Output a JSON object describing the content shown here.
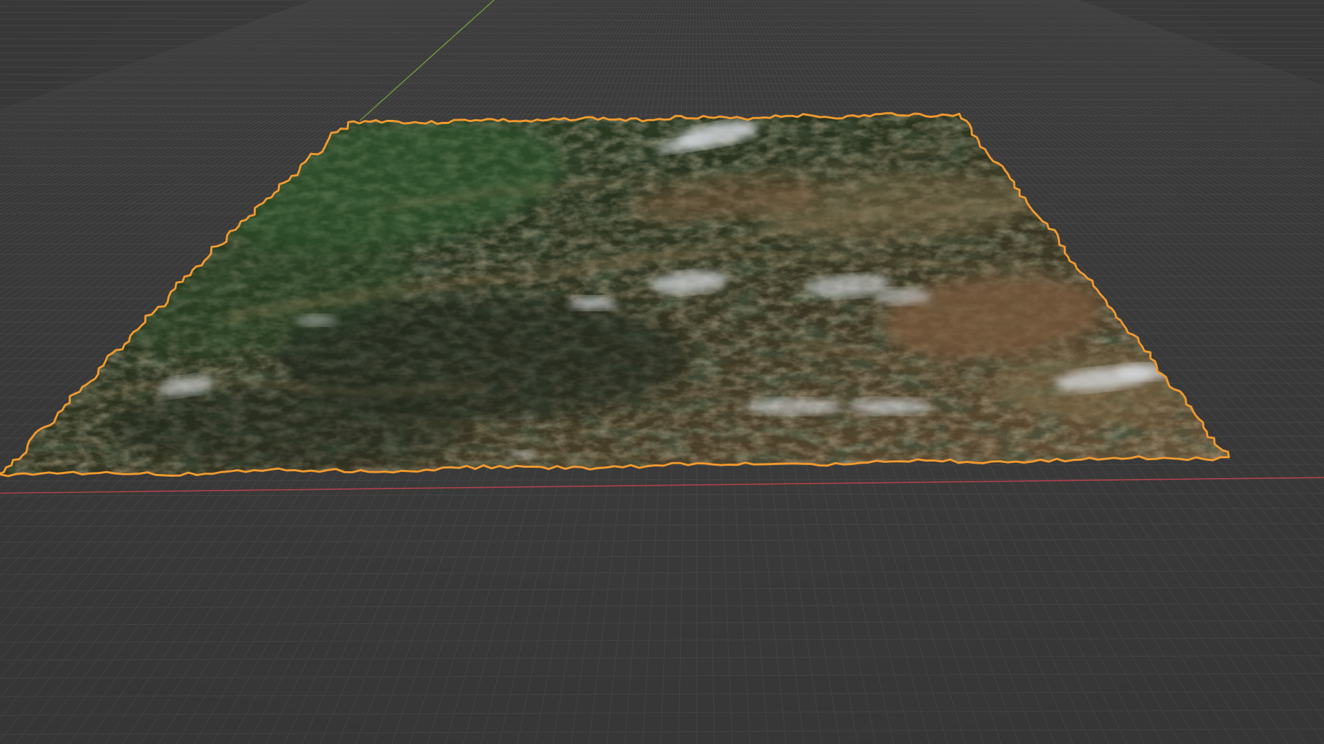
{
  "viewport": {
    "background": "#3d3d3d",
    "grid_color": "#4a4a4a",
    "grid_fade_color": "#444444",
    "axis_x_color": "#b3414c",
    "axis_y_color": "#6f9a3a",
    "selection_outline_color": "#f29a2e",
    "icon": "terrain-mesh-icon"
  },
  "terrain": {
    "forest_color": "#2e3b26",
    "dark_forest_color": "#1f281c",
    "valley_color": "#7d6a4a",
    "ridge_color": "#8a7655",
    "snow_color": "#d9dce0",
    "earth_color": "#7a5a3d"
  }
}
